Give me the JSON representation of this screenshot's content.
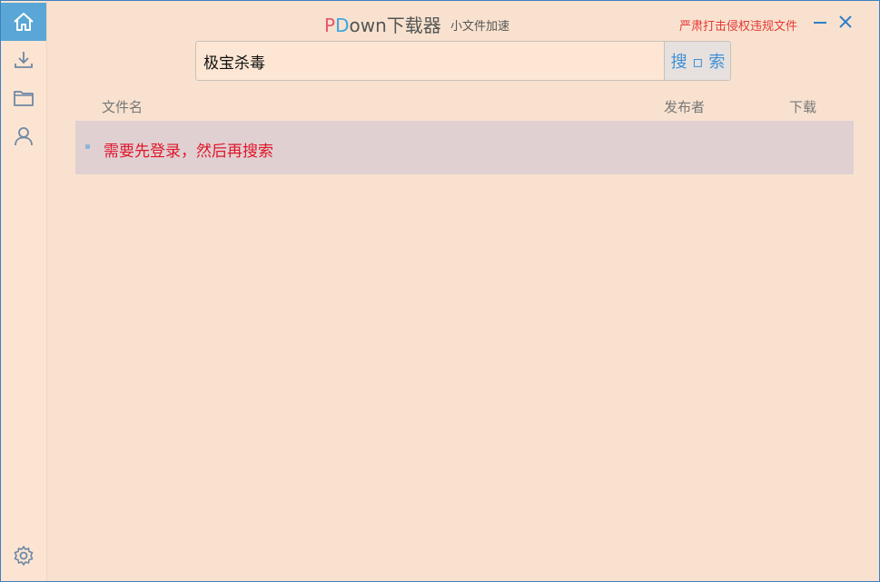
{
  "app": {
    "title_p": "P",
    "title_d": "D",
    "title_rest": "own下载器",
    "subtitle": "小文件加速",
    "warning": "严肃打击侵权违规文件"
  },
  "sidebar": {
    "items": [
      {
        "name": "home",
        "icon": "home-icon",
        "active": true
      },
      {
        "name": "downloads",
        "icon": "download-icon",
        "active": false
      },
      {
        "name": "files",
        "icon": "folder-icon",
        "active": false
      },
      {
        "name": "account",
        "icon": "user-icon",
        "active": false
      },
      {
        "name": "settings",
        "icon": "gear-icon",
        "active": false
      }
    ]
  },
  "search": {
    "value": "极宝杀毒",
    "button_label": "搜 ▫ 索"
  },
  "table": {
    "columns": [
      "文件名",
      "发布者",
      "下载"
    ],
    "rows": [
      {
        "message": "需要先登录，然后再搜索"
      }
    ]
  },
  "colors": {
    "accent": "#5aa6d6",
    "background": "#f8e2cf",
    "warning": "#e53935",
    "row_highlight": "#e0d0d1",
    "search_button_text": "#3f8fd6"
  }
}
